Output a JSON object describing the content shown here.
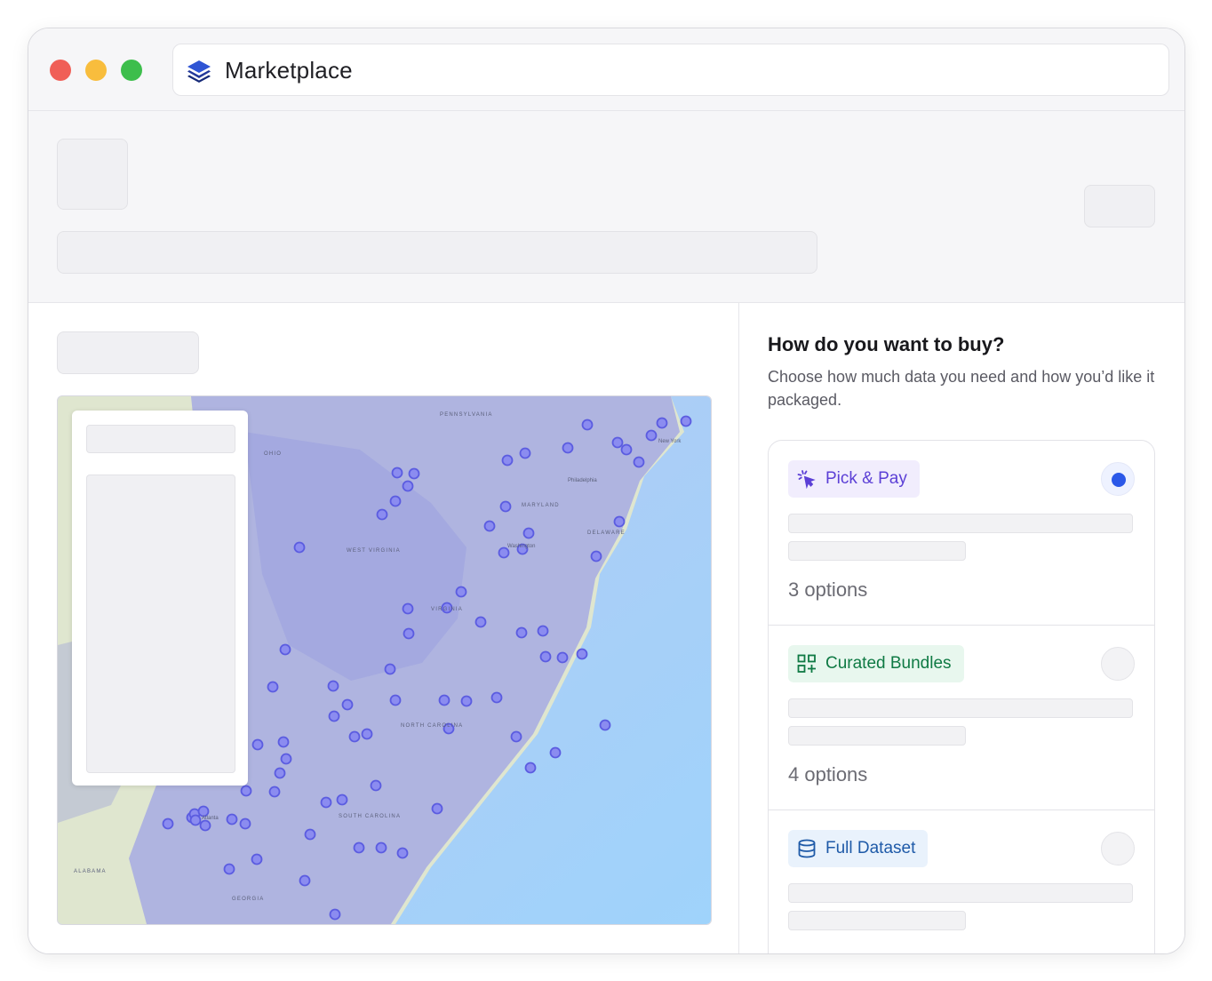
{
  "window": {
    "title": "Marketplace"
  },
  "purchase": {
    "heading": "How do you want to buy?",
    "subheading": "Choose how much data you need and how you’d like it packaged.",
    "options": [
      {
        "label": "Pick & Pay",
        "icon": "cursor-click-icon",
        "count": "3 options",
        "selected": true,
        "color": "#5b3fd6",
        "bg": "#f1edfd"
      },
      {
        "label": "Curated Bundles",
        "icon": "grid-plus-icon",
        "count": "4 options",
        "selected": false,
        "color": "#0f7a44",
        "bg": "#e8f7ee"
      },
      {
        "label": "Full Dataset",
        "icon": "database-icon",
        "count": "",
        "selected": false,
        "color": "#1e5aa8",
        "bg": "#e9f2fc"
      }
    ]
  },
  "colors": {
    "accent": "#2b58e8",
    "traffic_red": "#f05f57",
    "traffic_yellow": "#f8bd3d",
    "traffic_green": "#3dbe4c"
  },
  "map": {
    "labels": [
      "PENNSYLVANIA",
      "OHIO",
      "WEST VIRGINIA",
      "VIRGINIA",
      "MARYLAND",
      "DELAWARE",
      "NORTH CAROLINA",
      "SOUTH CAROLINA",
      "GEORGIA",
      "ALABAMA",
      "Philadelphia",
      "Washington",
      "New York",
      "Atlanta"
    ]
  }
}
